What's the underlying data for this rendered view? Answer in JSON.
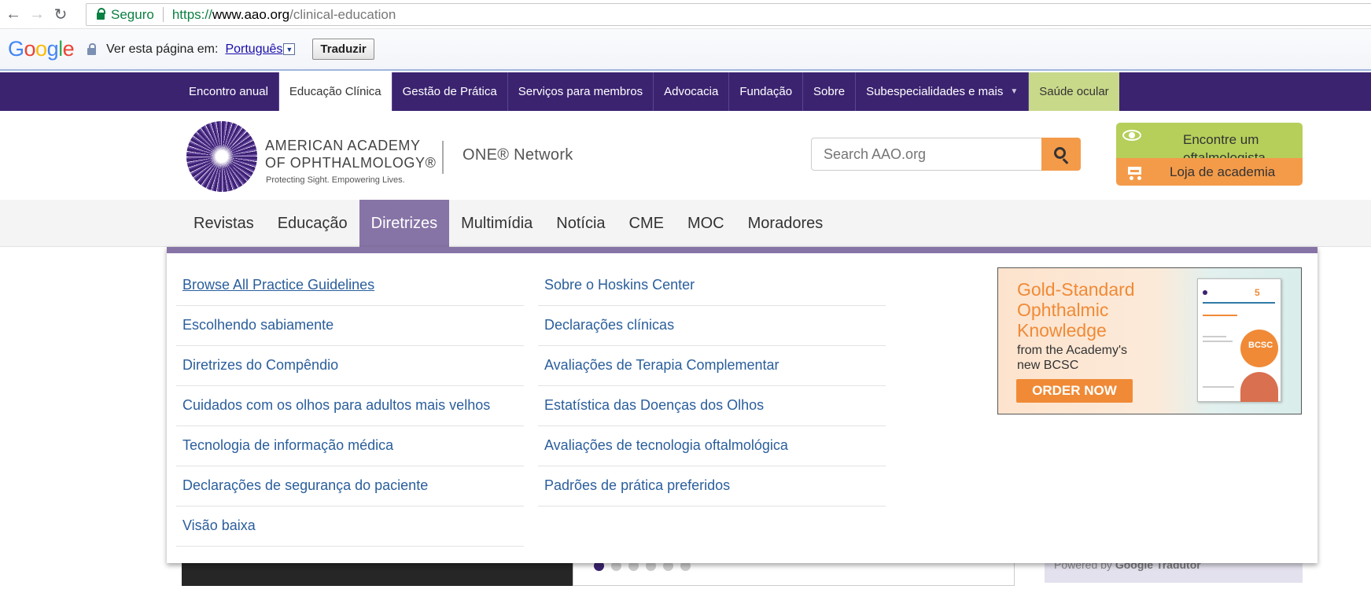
{
  "browser": {
    "secure_label": "Seguro",
    "url_scheme": "https://",
    "url_host": "www.aao.org",
    "url_path": "/clinical-education"
  },
  "translate_bar": {
    "logo": "Google",
    "label": "Ver esta página em:",
    "language": "Português",
    "button": "Traduzir"
  },
  "top_nav": {
    "items": [
      "Encontro anual",
      "Educação Clínica",
      "Gestão de Prática",
      "Serviços para membros",
      "Advocacia",
      "Fundação",
      "Sobre",
      "Subespecialidades e mais",
      "Saúde ocular"
    ],
    "active_index": 1
  },
  "header": {
    "org_line1": "AMERICAN ACADEMY",
    "org_line2": "OF OPHTHALMOLOGY®",
    "tagline": "Protecting Sight. Empowering Lives.",
    "network": "ONE® Network",
    "search_placeholder": "Search AAO.org",
    "find_button": "Encontre um oftalmologista",
    "store_button": "Loja de academia"
  },
  "sub_nav": {
    "items": [
      "Revistas",
      "Educação",
      "Diretrizes",
      "Multimídia",
      "Notícia",
      "CME",
      "MOC",
      "Moradores"
    ],
    "active_index": 2
  },
  "dropdown": {
    "col1": [
      "Browse All Practice Guidelines",
      "Escolhendo sabiamente",
      "Diretrizes do Compêndio",
      "Cuidados com os olhos para adultos mais velhos",
      "Tecnologia de informação médica",
      "Declarações de segurança do paciente",
      "Visão baixa"
    ],
    "col2": [
      "Sobre o Hoskins Center",
      "Declarações clínicas",
      "Avaliações de Terapia Complementar",
      "Estatística das Doenças dos Olhos",
      "Avaliações de tecnologia oftalmológica",
      "Padrões de prática preferidos"
    ],
    "ad": {
      "headline1": "Gold-Standard",
      "headline2": "Ophthalmic",
      "headline3": "Knowledge",
      "sub1": "from the Academy's",
      "sub2": "new BCSC",
      "button": "ORDER NOW",
      "book_number": "5",
      "book_badge": "BCSC"
    }
  },
  "background": {
    "powered_prefix": "Powered by",
    "powered_brand": "Google Tradutor"
  },
  "colors": {
    "nav_purple": "#3b2370",
    "accent_lavender": "#8774a6",
    "link_blue": "#2a5e9c",
    "orange": "#f49b4a",
    "green": "#b5cf5a"
  }
}
